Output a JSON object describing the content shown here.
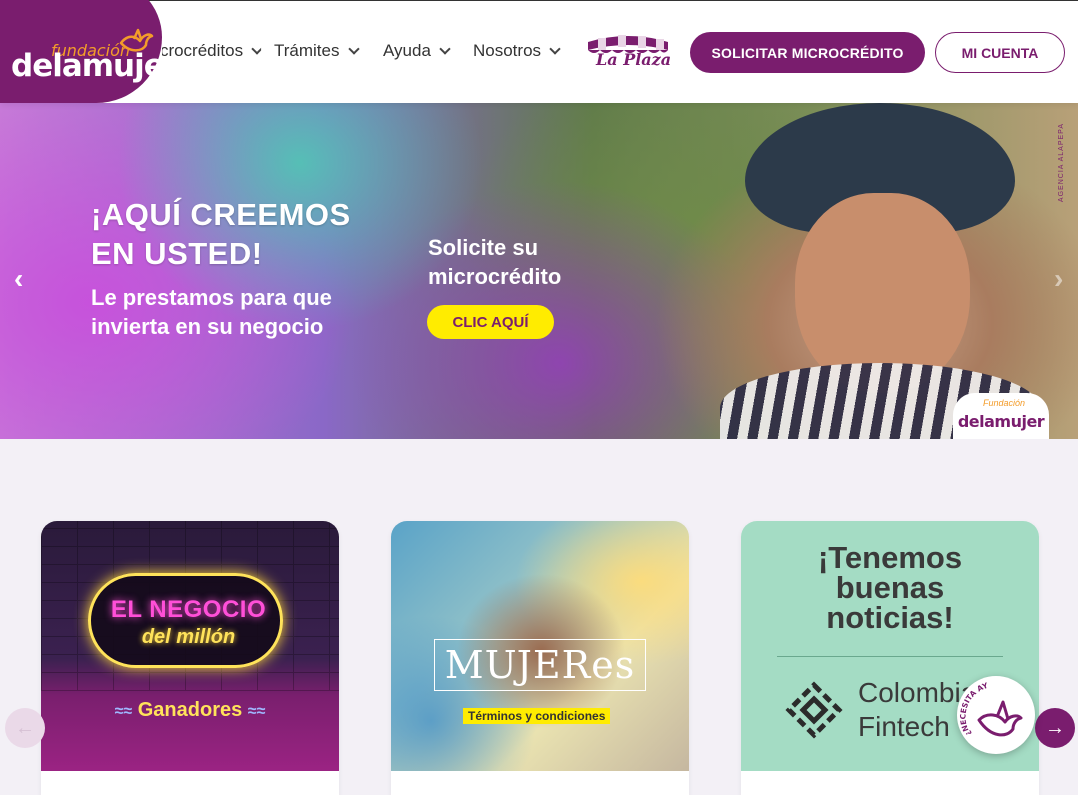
{
  "header": {
    "logo_top": "fundación",
    "logo_main": "delamujer",
    "nav": [
      {
        "label": "Microcréditos"
      },
      {
        "label": "Trámites"
      },
      {
        "label": "Ayuda"
      },
      {
        "label": "Nosotros"
      }
    ],
    "laplaza_label": "La Plaza",
    "solicitar_label": "SOLICITAR MICROCRÉDITO",
    "cuenta_label": "MI CUENTA"
  },
  "hero": {
    "title_line1": "¡AQUÍ CREEMOS",
    "title_line2": "EN USTED!",
    "sub_line1": "Le prestamos para que",
    "sub_line2": "invierta en su negocio",
    "cta_line1": "Solicite su",
    "cta_line2": "microcrédito",
    "cta_button": "CLIC AQUÍ",
    "prev_arrow": "‹",
    "next_arrow": "›",
    "corner_logo_top": "Fundación",
    "corner_logo_main": "delamujer",
    "agency": "AGENCIA ALAPEPA"
  },
  "cards": [
    {
      "line1": "EL NEGOCIO",
      "line2": "del millón",
      "caption": "Ganadores",
      "wave": "≈≈"
    },
    {
      "title": "MUJERes",
      "caption": "Términos y condiciones"
    },
    {
      "line1": "¡Tenemos",
      "line2": "buenas",
      "line3": "noticias!",
      "brand_line1": "Colombia",
      "brand_line2": "Fintech"
    }
  ],
  "slider": {
    "prev": "←",
    "next": "→"
  },
  "help": {
    "label": "¿NECESITA AYUDA?"
  },
  "colors": {
    "brand": "#7a1d6e",
    "accent": "#ffec00",
    "orange": "#f39c2a"
  }
}
